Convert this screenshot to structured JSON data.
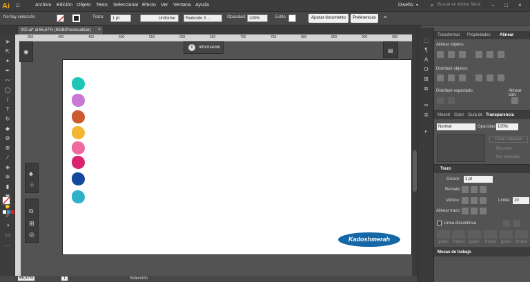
{
  "app": {
    "logo": "Ai",
    "home_icon": "home-icon",
    "accent": "#f7a21b"
  },
  "menu": [
    "Archivo",
    "Edición",
    "Objeto",
    "Texto",
    "Seleccionar",
    "Efecto",
    "Ver",
    "Ventana",
    "Ayuda"
  ],
  "workspace": {
    "label": "Diseño",
    "search_placeholder": "Buscar en Adobe Stock"
  },
  "control_bar": {
    "selection": "No hay selección",
    "stroke_label": "Trazo:",
    "stroke_value": "1 pt",
    "profile": "Uniforme",
    "brush": "Redondo 3 ...",
    "opacity_label": "Opacidad:",
    "opacity_value": "100%",
    "style_label": "Estilo:",
    "adjust_doc": "Ajustar documento",
    "preferences": "Preferencias"
  },
  "document_tab": {
    "title": "002.ai* al 66,67% (RGB/Previsualizar)",
    "close": "×"
  },
  "ruler": {
    "marks": [
      "350",
      "400",
      "450",
      "500",
      "550",
      "600",
      "650",
      "700",
      "750",
      "800",
      "850",
      "900",
      "950"
    ]
  },
  "info_panel": {
    "title": "Información"
  },
  "artboard": {
    "swatches": [
      "#1ec6b6",
      "#c678d4",
      "#cc5a2e",
      "#f2b632",
      "#f06a9e",
      "#d8236f",
      "#14489e",
      "#2fb2c8"
    ],
    "brand_text": "Kadoshmerah",
    "brand_color": "#1567a6"
  },
  "status": {
    "zoom": "66,67%",
    "page": "1",
    "tool": "Selección"
  },
  "right_panel": {
    "tabs1": [
      "Transformar",
      "Propiedades",
      "Alinear"
    ],
    "align_objects": "Alinear objetos:",
    "distribute_objects": "Distribuir objetos:",
    "distribute_spacing": "Distribuir espaciado:",
    "align_to": "Alinear con:",
    "tabs2": [
      "Muestr",
      "Color",
      "Guía de",
      "Transparencia"
    ],
    "blend_mode": "Normal",
    "opacity_label": "Opacidad:",
    "opacity_value": "100%",
    "make_mask": "Crear máscara",
    "clip": "Recortar",
    "invert_mask": "Inv. máscara",
    "stroke_title": "Trazo",
    "weight_label": "Grosor:",
    "weight_value": "1 pt",
    "cap_label": "Remate:",
    "corner_label": "Vértice:",
    "limit_label": "Límite:",
    "limit_value": "10",
    "align_stroke_label": "Alinear trazo:",
    "dashed": "Línea discontinua",
    "dash_labels": [
      "guión",
      "hueco",
      "guión",
      "hueco",
      "guión",
      "hueco"
    ],
    "artboards": "Mesas de trabajo"
  }
}
